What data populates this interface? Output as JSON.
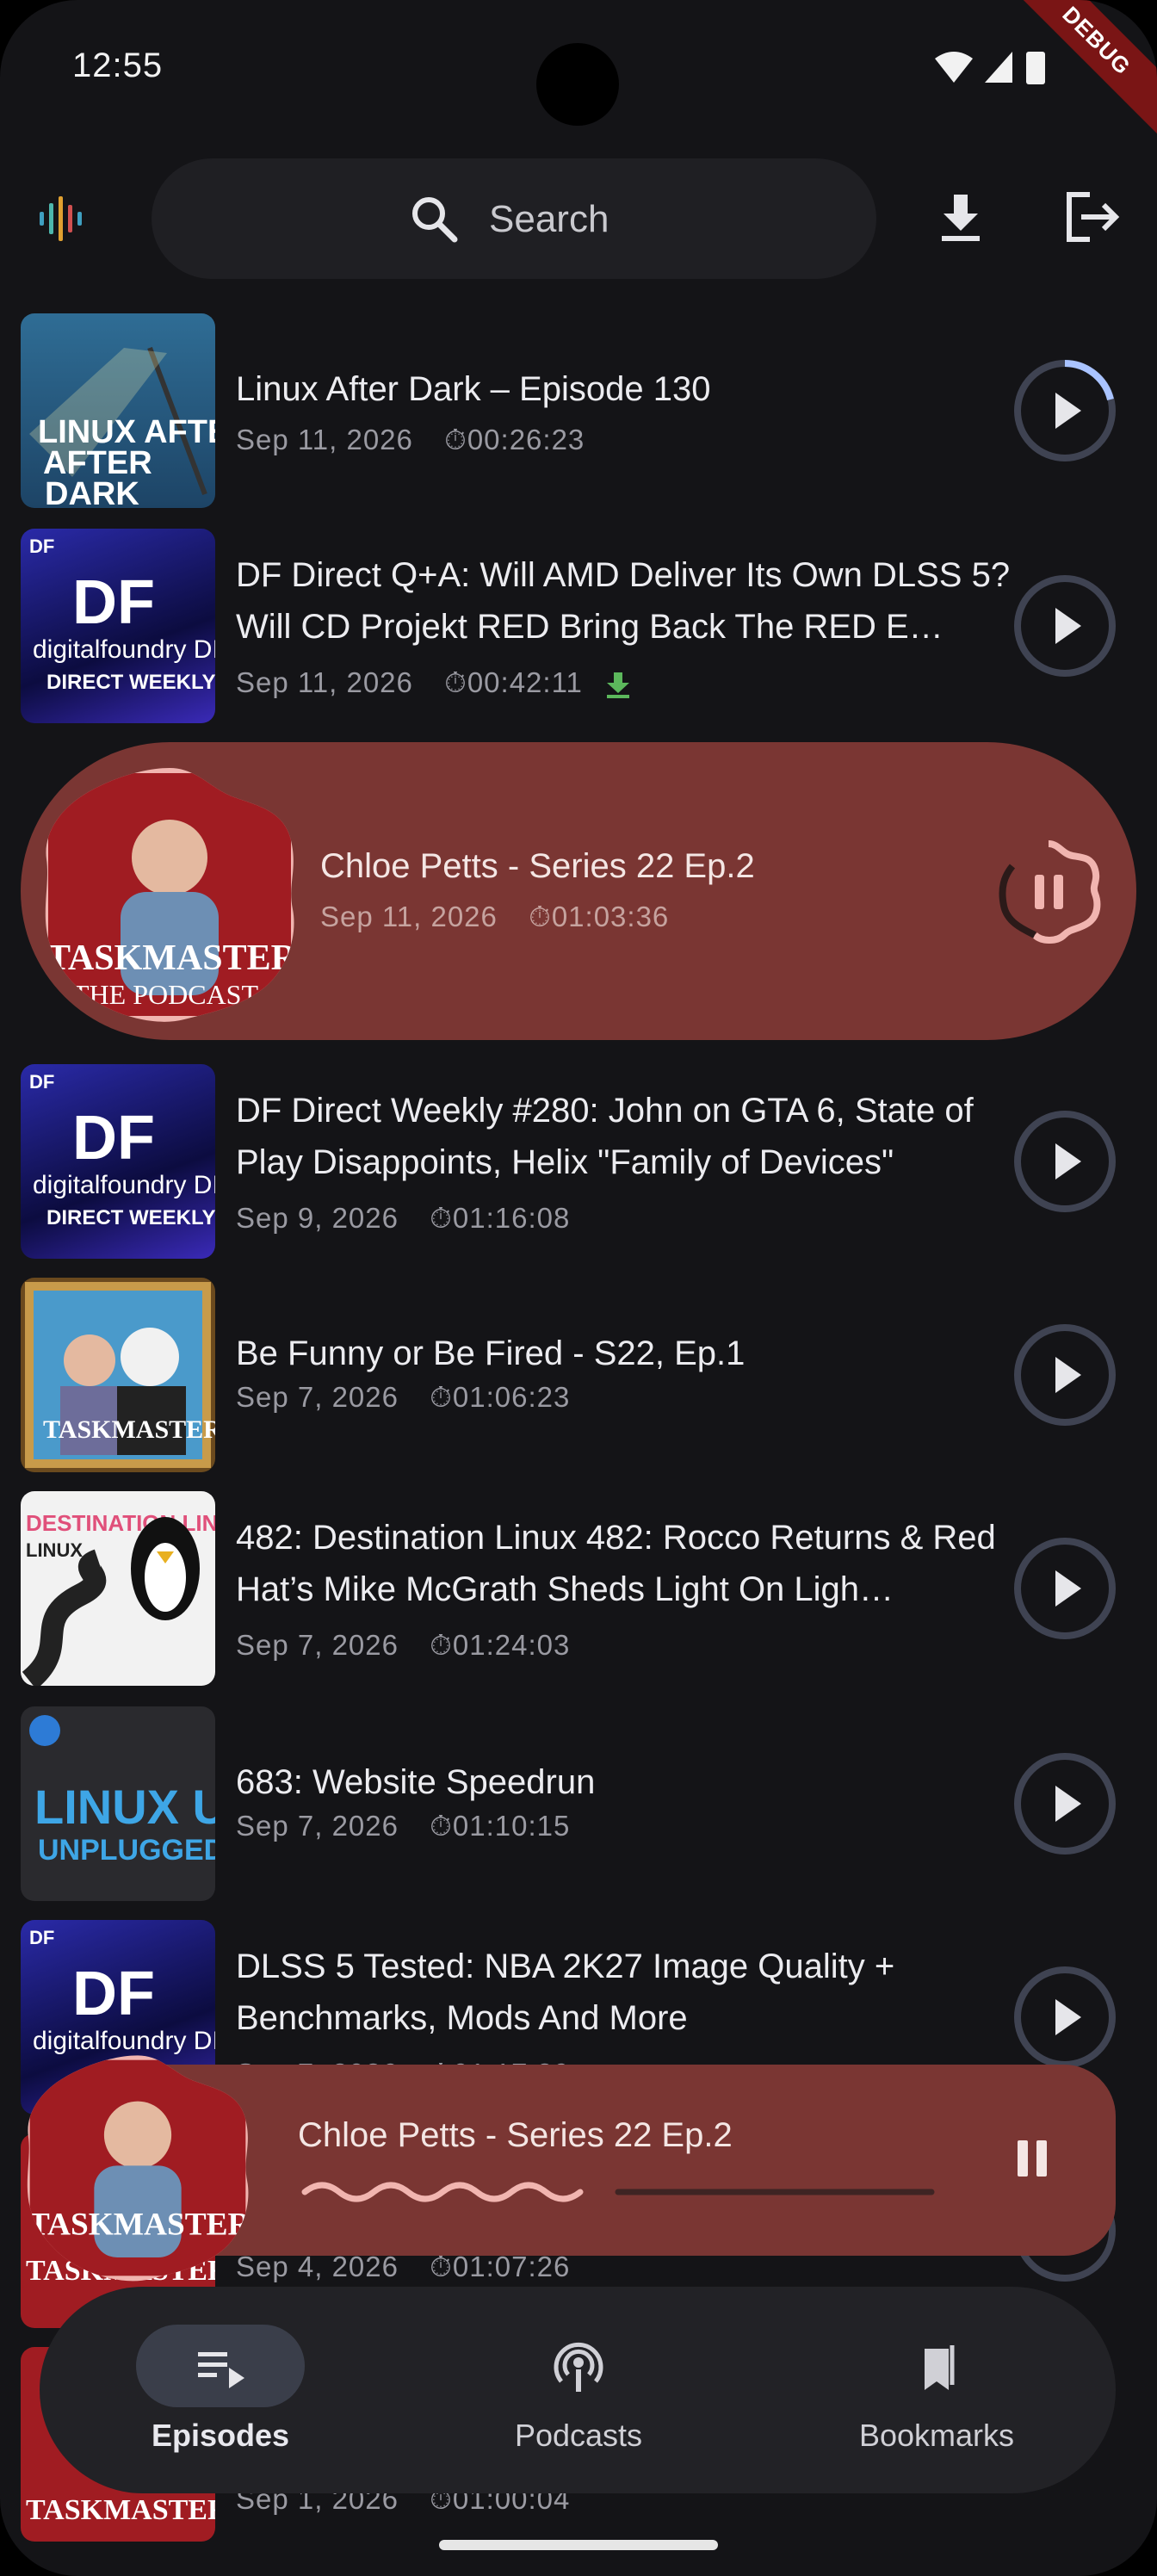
{
  "status_bar": {
    "time": "12:55",
    "debug_banner": "DEBUG"
  },
  "search": {
    "placeholder": "Search"
  },
  "episodes": [
    {
      "title": "Linux After Dark – Episode 130",
      "date": "Sep 11, 2026",
      "duration": "00:26:23",
      "art": "LINUX AFTER DARK",
      "progress": 0.15
    },
    {
      "title": "DF Direct Q+A: Will AMD Deliver Its Own DLSS 5? Will CD Projekt RED Bring Back The RED E…",
      "date": "Sep 11, 2026",
      "duration": "00:42:11",
      "downloaded": true,
      "art": "digitalfoundry DIRECT WEEKLY"
    },
    {
      "title": "Chloe Petts - Series 22 Ep.2",
      "date": "Sep 11, 2026",
      "duration": "01:03:36",
      "art": "TASKMASTER THE PODCAST",
      "playing": true
    },
    {
      "title": "DF Direct Weekly #280: John on GTA 6, State of Play Disappoints, Helix \"Family of Devices\"",
      "date": "Sep 9, 2026",
      "duration": "01:16:08",
      "art": "digitalfoundry DIRECT WEEKLY"
    },
    {
      "title": "Be Funny or Be Fired - S22, Ep.1",
      "date": "Sep 7, 2026",
      "duration": "01:06:23",
      "art": "TASKMASTER The People's Podcast"
    },
    {
      "title": "482: Destination Linux 482: Rocco Returns & Red Hat’s Mike McGrath Sheds Light On Ligh…",
      "date": "Sep 7, 2026",
      "duration": "01:24:03",
      "art": "DESTINATION LINUX PODCAST"
    },
    {
      "title": "683: Website Speedrun",
      "date": "Sep 7, 2026",
      "duration": "01:10:15",
      "art": "LINUX UNPLUGGED"
    },
    {
      "title": "DLSS 5 Tested: NBA 2K27 Image Quality + Benchmarks, Mods And More",
      "date": "Sep 7, 2026",
      "duration": "01:17:39",
      "art": "digitalfoundry DIRECT WEEKLY"
    },
    {
      "title": "",
      "date": "Sep 4, 2026",
      "duration": "01:07:26",
      "art": "TASKMASTER THE PODCAST"
    },
    {
      "title": "",
      "date": "Sep 1, 2026",
      "duration": "01:00:04",
      "art": "TASKMASTER THE PODCAST"
    }
  ],
  "mini_player": {
    "title": "Chloe Petts - Series 22 Ep.2",
    "progress": 0.34,
    "art": "TASKMASTER THE PODCAST"
  },
  "nav": {
    "items": [
      {
        "label": "Episodes",
        "icon": "episodes-icon",
        "active": true
      },
      {
        "label": "Podcasts",
        "icon": "podcasts-icon"
      },
      {
        "label": "Bookmarks",
        "icon": "bookmarks-icon"
      }
    ]
  },
  "colors": {
    "accent": "#7a3633",
    "background": "#141417",
    "downloaded": "#5cb85c",
    "progress": "#a9c3ff"
  }
}
